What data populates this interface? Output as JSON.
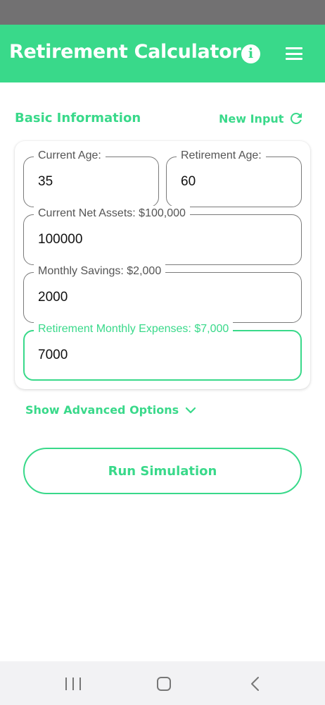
{
  "header": {
    "title": "Retirement Calculator",
    "info_icon": "info-icon",
    "menu_icon": "menu-icon"
  },
  "section": {
    "title": "Basic Information",
    "new_input_label": "New Input",
    "new_input_icon": "refresh-icon"
  },
  "fields": {
    "current_age": {
      "label": "Current Age:",
      "value": "35"
    },
    "retirement_age": {
      "label": "Retirement Age:",
      "value": "60"
    },
    "net_assets": {
      "label": "Current Net Assets: $100,000",
      "value": "100000"
    },
    "monthly_savings": {
      "label": "Monthly Savings: $2,000",
      "value": "2000"
    },
    "retirement_expenses": {
      "label": "Retirement Monthly Expenses: $7,000",
      "value": "7000"
    }
  },
  "advanced": {
    "label": "Show Advanced Options",
    "icon": "chevron-down-icon"
  },
  "actions": {
    "run_label": "Run Simulation"
  },
  "colors": {
    "accent": "#39d98a",
    "status_bar": "#727172",
    "nav_bar": "#f2f2f4"
  }
}
